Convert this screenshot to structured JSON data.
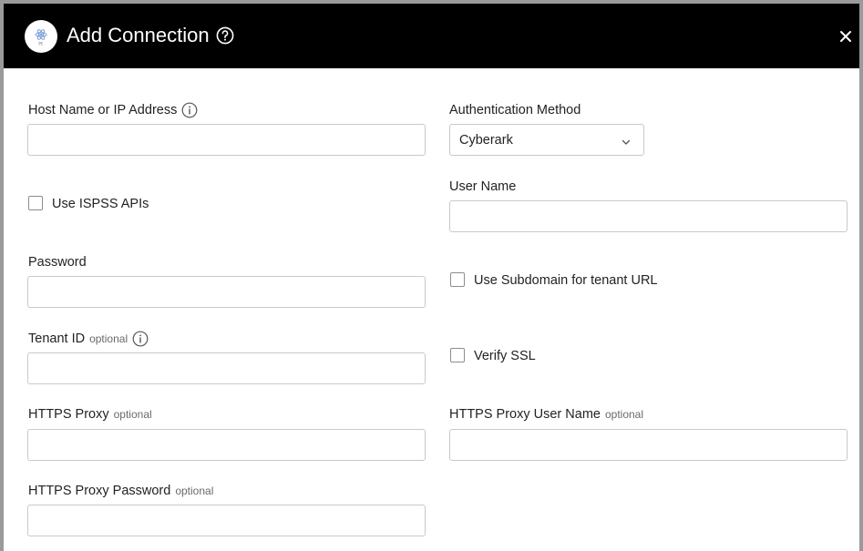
{
  "dialog": {
    "title": "Add Connection",
    "logo_icon": "app-logo-icon",
    "help_icon": "help-circle-icon",
    "close_icon": "close-icon"
  },
  "form": {
    "host": {
      "label": "Host Name or IP Address",
      "value": "",
      "placeholder": ""
    },
    "auth_method": {
      "label": "Authentication Method",
      "selected": "Cyberark"
    },
    "use_ispss": {
      "label": "Use ISPSS APIs",
      "checked": false
    },
    "user_name": {
      "label": "User Name",
      "value": ""
    },
    "password": {
      "label": "Password",
      "value": ""
    },
    "use_subdomain": {
      "label": "Use Subdomain for tenant URL",
      "checked": false
    },
    "tenant_id": {
      "label": "Tenant ID",
      "optional": "optional",
      "value": ""
    },
    "verify_ssl": {
      "label": "Verify SSL",
      "checked": false
    },
    "https_proxy": {
      "label": "HTTPS Proxy",
      "optional": "optional",
      "value": ""
    },
    "https_proxy_user": {
      "label": "HTTPS Proxy User Name",
      "optional": "optional",
      "value": ""
    },
    "https_proxy_password": {
      "label": "HTTPS Proxy Password",
      "optional": "optional",
      "value": ""
    }
  },
  "colors": {
    "header_bg": "#000000",
    "header_text": "#ffffff",
    "border": "#c9c9c9",
    "frame": "#9a9a9a"
  }
}
